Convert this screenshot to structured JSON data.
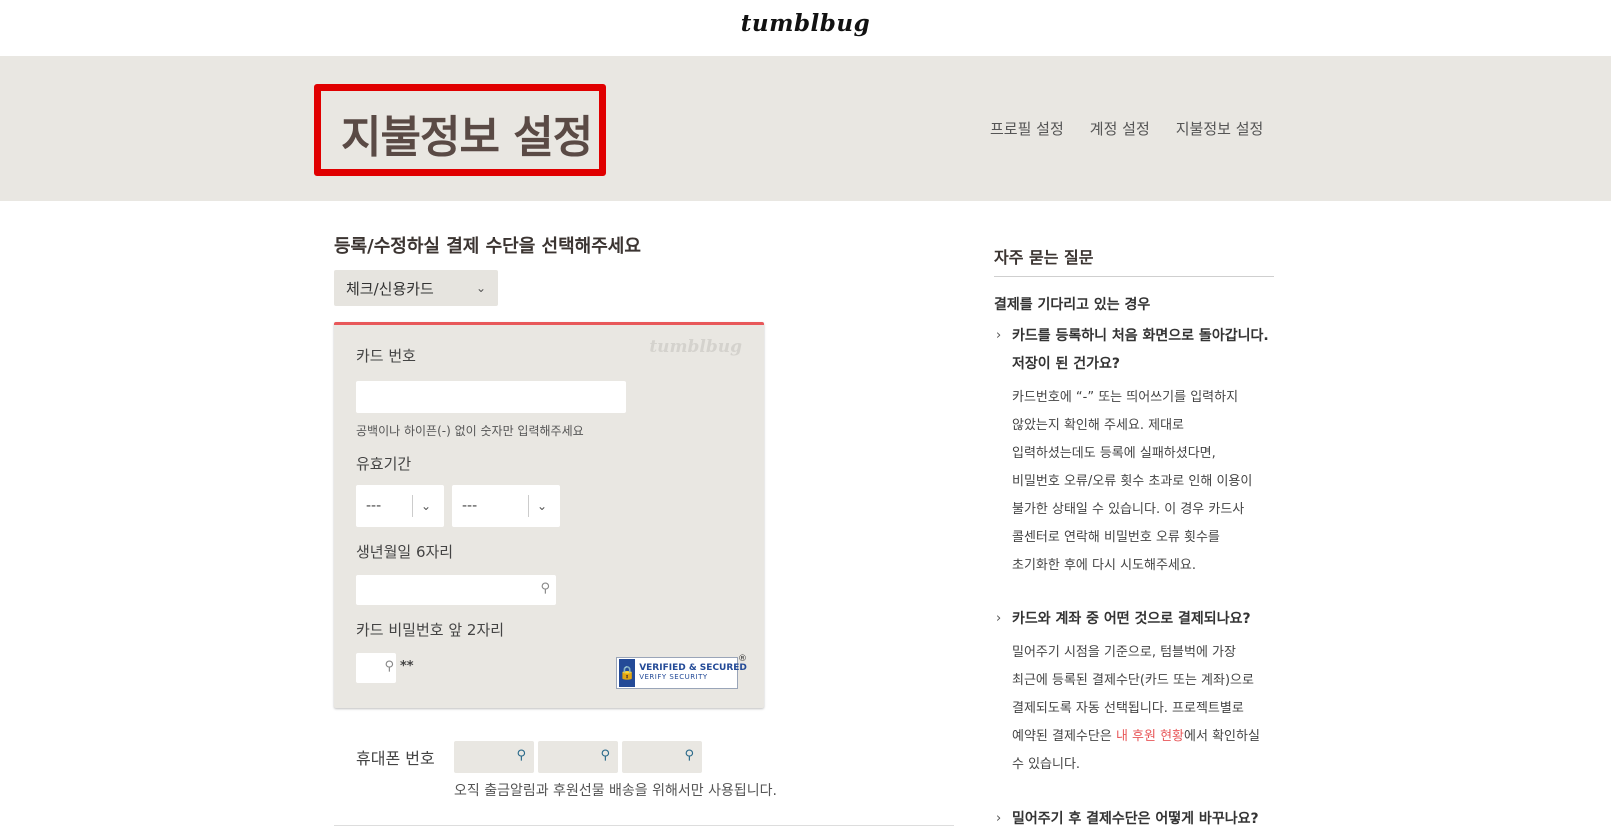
{
  "logo": "tumblbug",
  "header": {
    "title": "지불정보 설정",
    "nav": [
      "프로필 설정",
      "계정 설정",
      "지불정보 설정"
    ]
  },
  "payment": {
    "section_title": "등록/수정하실 결제 수단을 선택해주세요",
    "method_selected": "체크/신용카드",
    "watermark": "tumblbug",
    "card_number_label": "카드 번호",
    "card_number_hint": "공백이나 하이픈(-) 없이 숫자만 입력해주세요",
    "expiry_label": "유효기간",
    "expiry_month": "---",
    "expiry_year": "---",
    "birth_label": "생년월일 6자리",
    "pin_label": "카드 비밀번호 앞 2자리",
    "pin_suffix": "**",
    "badge_line1": "VERIFIED & SECURED",
    "badge_line2": "VERIFY SECURITY",
    "badge_reg": "®",
    "phone_label": "휴대폰 번호",
    "phone_hint": "오직 출금알림과 후원선물 배송을 위해서만 사용됩니다."
  },
  "faq": {
    "title": "자주 묻는 질문",
    "subtitle": "결제를 기다리고 있는 경우",
    "items": [
      {
        "q1": "카드를 등록하니 처음 화면으로 돌아갑니다.",
        "q2": "저장이 된 건가요?",
        "a": [
          "카드번호에 “-” 또는 띄어쓰기를 입력하지",
          "않았는지 확인해 주세요. 제대로",
          "입력하셨는데도 등록에 실패하셨다면,",
          "비밀번호 오류/오류 횟수 초과로 인해 이용이",
          "불가한 상태일 수 있습니다. 이 경우 카드사",
          "콜센터로 연락해 비밀번호 오류 횟수를",
          "초기화한 후에 다시 시도해주세요."
        ]
      },
      {
        "q1": "카드와 계좌 중 어떤 것으로 결제되나요?",
        "a": [
          "밀어주기 시점을 기준으로, 텀블벅에 가장",
          "최근에 등록된 결제수단(카드 또는 계좌)으로",
          "결제되도록 자동 선택됩니다. 프로젝트별로"
        ],
        "a_pre": "예약된 결제수단은 ",
        "a_link": "내 후원 현황",
        "a_post": "에서 확인하실",
        "a_last": "수 있습니다."
      },
      {
        "q1": "밀어주기 후 결제수단은 어떻게 바꾸나요?"
      }
    ]
  }
}
